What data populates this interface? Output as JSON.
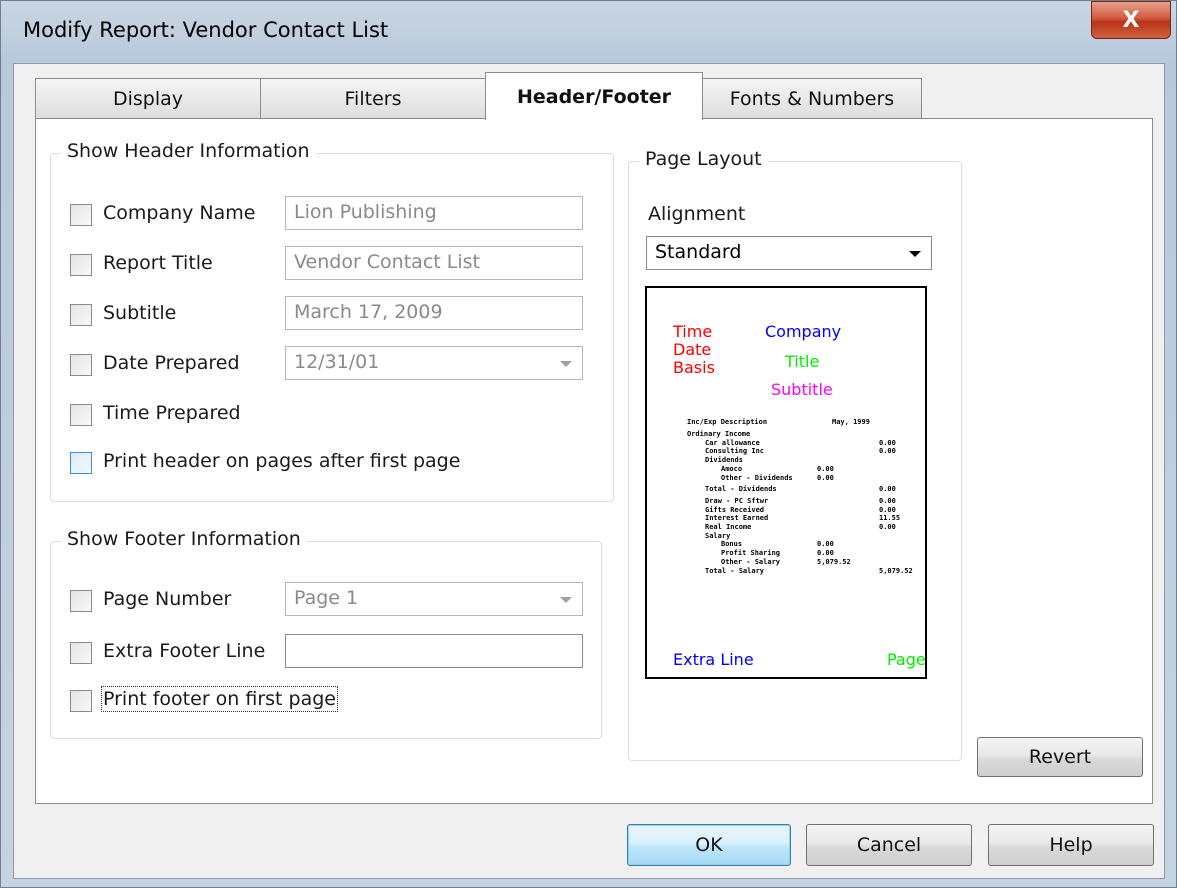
{
  "window": {
    "title": "Modify Report: Vendor Contact List",
    "close_label": "X"
  },
  "tabs": [
    {
      "label": "Display",
      "active": false
    },
    {
      "label": "Filters",
      "active": false
    },
    {
      "label": "Header/Footer",
      "active": true
    },
    {
      "label": "Fonts & Numbers",
      "active": false
    }
  ],
  "header_group": {
    "title": "Show Header Information",
    "company_name": {
      "label": "Company Name",
      "value": "Lion Publishing",
      "checked": false
    },
    "report_title": {
      "label": "Report Title",
      "value": "Vendor Contact List",
      "checked": false
    },
    "subtitle": {
      "label": "Subtitle",
      "value": "March 17, 2009",
      "checked": false
    },
    "date_prepared": {
      "label": "Date Prepared",
      "value": "12/31/01",
      "checked": false
    },
    "time_prepared": {
      "label": "Time Prepared",
      "checked": false
    },
    "print_header": {
      "label": "Print header on pages after first page",
      "checked": false
    }
  },
  "footer_group": {
    "title": "Show Footer Information",
    "page_number": {
      "label": "Page Number",
      "value": "Page 1",
      "checked": false
    },
    "extra_footer": {
      "label": "Extra Footer Line",
      "value": "",
      "checked": false
    },
    "print_footer": {
      "label": "Print footer on first page",
      "checked": false
    }
  },
  "layout_group": {
    "title": "Page Layout",
    "alignment_label": "Alignment",
    "alignment_value": "Standard"
  },
  "preview": {
    "time": "Time",
    "date": "Date",
    "basis": "Basis",
    "company": "Company",
    "title": "Title",
    "subtitle": "Subtitle",
    "extra_line": "Extra Line",
    "page": "Page",
    "colors": {
      "red": "#ff0000",
      "blue": "#0000ff",
      "green": "#00ee00",
      "magenta": "#ff00ff"
    },
    "sample_rows": [
      {
        "text": "Inc/Exp Description",
        "x": 0,
        "val": "May, 1999",
        "col": 0
      },
      {
        "text": "Ordinary Income",
        "x": 0,
        "val": "",
        "col": 0
      },
      {
        "text": "Car allowance",
        "x": 1,
        "val": "0.00",
        "col": 2
      },
      {
        "text": "Consulting Inc",
        "x": 1,
        "val": "0.00",
        "col": 2
      },
      {
        "text": "Dividends",
        "x": 1,
        "val": "",
        "col": 0
      },
      {
        "text": "Amoco",
        "x": 2,
        "val": "0.00",
        "col": 1
      },
      {
        "text": "Other - Dividends",
        "x": 2,
        "val": "0.00",
        "col": 1
      },
      {
        "text": "Total - Dividends",
        "x": 1,
        "val": "0.00",
        "col": 2
      },
      {
        "text": "Draw - PC Sftwr",
        "x": 1,
        "val": "0.00",
        "col": 2
      },
      {
        "text": "Gifts Received",
        "x": 1,
        "val": "0.00",
        "col": 2
      },
      {
        "text": "Interest Earned",
        "x": 1,
        "val": "11.55",
        "col": 2
      },
      {
        "text": "Real Income",
        "x": 1,
        "val": "0.00",
        "col": 2
      },
      {
        "text": "Salary",
        "x": 1,
        "val": "",
        "col": 0
      },
      {
        "text": "Bonus",
        "x": 2,
        "val": "0.00",
        "col": 1
      },
      {
        "text": "Profit Sharing",
        "x": 2,
        "val": "0.00",
        "col": 1
      },
      {
        "text": "Other - Salary",
        "x": 2,
        "val": "5,079.52",
        "col": 1
      },
      {
        "text": "Total - Salary",
        "x": 1,
        "val": "5,079.52",
        "col": 2
      }
    ]
  },
  "buttons": {
    "revert": "Revert",
    "ok": "OK",
    "cancel": "Cancel",
    "help": "Help"
  }
}
